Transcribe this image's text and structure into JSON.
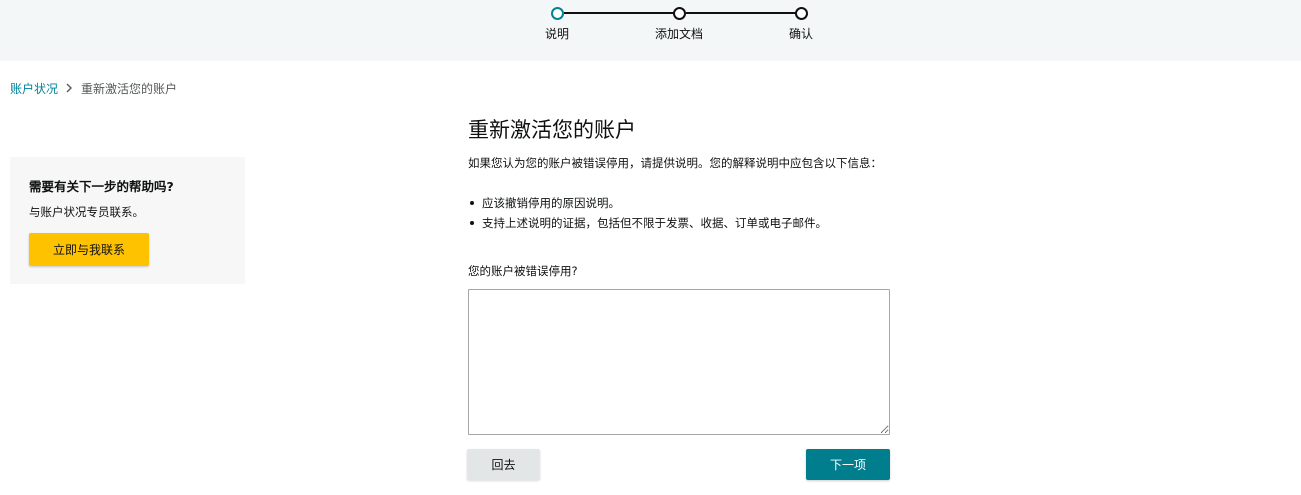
{
  "stepper": {
    "steps": [
      {
        "label": "说明",
        "state": "current"
      },
      {
        "label": "添加文档",
        "state": "upcoming"
      },
      {
        "label": "确认",
        "state": "upcoming"
      }
    ],
    "active_color": "#00839b"
  },
  "breadcrumb": {
    "parent_label": "账户状况",
    "separator": "›",
    "current_label": "重新激活您的账户"
  },
  "help_panel": {
    "title": "需要有关下一步的帮助吗?",
    "text": "与账户状况专员联系。",
    "button_label": "立即与我联系",
    "button_color": "#ffc200"
  },
  "main": {
    "title": "重新激活您的账户",
    "intro": "如果您认为您的账户被错误停用，请提供说明。您的解释说明中应包含以下信息：",
    "bullets": [
      "应该撤销停用的原因说明。",
      "支持上述说明的证据，包括但不限于发票、收据、订单或电子邮件。"
    ],
    "question_label": "您的账户被错误停用?",
    "textarea_value": "",
    "back_label": "回去",
    "next_label": "下一项",
    "next_color": "#007e8e"
  }
}
